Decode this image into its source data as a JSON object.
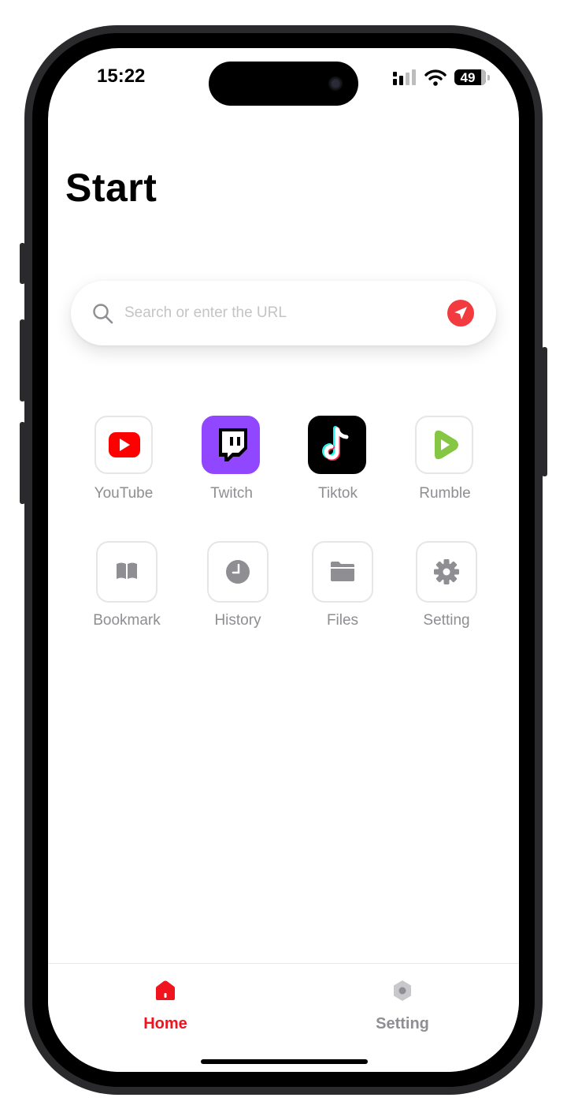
{
  "status_bar": {
    "time": "15:22",
    "battery": "49"
  },
  "header": {
    "title": "Start"
  },
  "search": {
    "placeholder": "Search or enter the URL",
    "value": ""
  },
  "apps": [
    {
      "label": "YouTube",
      "icon": "youtube-icon"
    },
    {
      "label": "Twitch",
      "icon": "twitch-icon"
    },
    {
      "label": "Tiktok",
      "icon": "tiktok-icon"
    },
    {
      "label": "Rumble",
      "icon": "rumble-icon"
    }
  ],
  "tools": [
    {
      "label": "Bookmark",
      "icon": "book-icon"
    },
    {
      "label": "History",
      "icon": "clock-icon"
    },
    {
      "label": "Files",
      "icon": "folder-icon"
    },
    {
      "label": "Setting",
      "icon": "gear-icon"
    }
  ],
  "tab_bar": {
    "tabs": [
      {
        "label": "Home",
        "icon": "home-icon",
        "active": true
      },
      {
        "label": "Setting",
        "icon": "settings-hex-icon",
        "active": false
      }
    ]
  },
  "colors": {
    "accent": "#f0141e",
    "send_button": "#f23a3f",
    "label_gray": "#8e8e93",
    "twitch": "#9146ff",
    "youtube": "#ff0000",
    "rumble": "#85c742"
  }
}
